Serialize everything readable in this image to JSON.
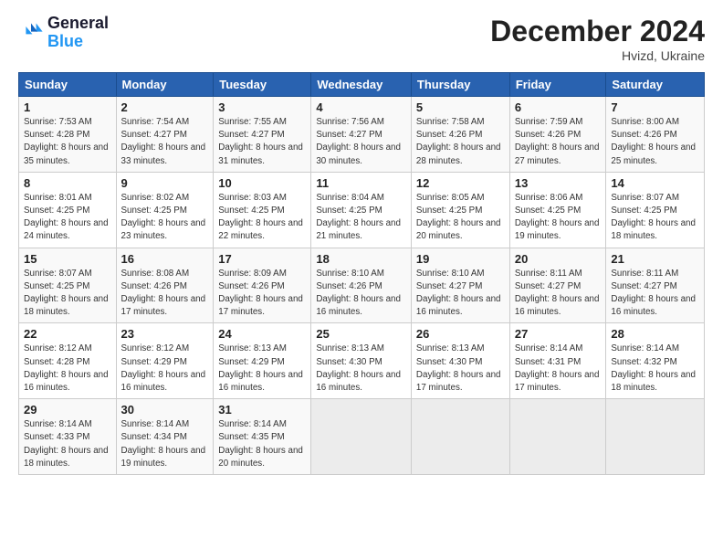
{
  "header": {
    "logo_line1": "General",
    "logo_line2": "Blue",
    "month": "December 2024",
    "location": "Hvizd, Ukraine"
  },
  "weekdays": [
    "Sunday",
    "Monday",
    "Tuesday",
    "Wednesday",
    "Thursday",
    "Friday",
    "Saturday"
  ],
  "weeks": [
    [
      {
        "day": "1",
        "info": "Sunrise: 7:53 AM\nSunset: 4:28 PM\nDaylight: 8 hours\nand 35 minutes."
      },
      {
        "day": "2",
        "info": "Sunrise: 7:54 AM\nSunset: 4:27 PM\nDaylight: 8 hours\nand 33 minutes."
      },
      {
        "day": "3",
        "info": "Sunrise: 7:55 AM\nSunset: 4:27 PM\nDaylight: 8 hours\nand 31 minutes."
      },
      {
        "day": "4",
        "info": "Sunrise: 7:56 AM\nSunset: 4:27 PM\nDaylight: 8 hours\nand 30 minutes."
      },
      {
        "day": "5",
        "info": "Sunrise: 7:58 AM\nSunset: 4:26 PM\nDaylight: 8 hours\nand 28 minutes."
      },
      {
        "day": "6",
        "info": "Sunrise: 7:59 AM\nSunset: 4:26 PM\nDaylight: 8 hours\nand 27 minutes."
      },
      {
        "day": "7",
        "info": "Sunrise: 8:00 AM\nSunset: 4:26 PM\nDaylight: 8 hours\nand 25 minutes."
      }
    ],
    [
      {
        "day": "8",
        "info": "Sunrise: 8:01 AM\nSunset: 4:25 PM\nDaylight: 8 hours\nand 24 minutes."
      },
      {
        "day": "9",
        "info": "Sunrise: 8:02 AM\nSunset: 4:25 PM\nDaylight: 8 hours\nand 23 minutes."
      },
      {
        "day": "10",
        "info": "Sunrise: 8:03 AM\nSunset: 4:25 PM\nDaylight: 8 hours\nand 22 minutes."
      },
      {
        "day": "11",
        "info": "Sunrise: 8:04 AM\nSunset: 4:25 PM\nDaylight: 8 hours\nand 21 minutes."
      },
      {
        "day": "12",
        "info": "Sunrise: 8:05 AM\nSunset: 4:25 PM\nDaylight: 8 hours\nand 20 minutes."
      },
      {
        "day": "13",
        "info": "Sunrise: 8:06 AM\nSunset: 4:25 PM\nDaylight: 8 hours\nand 19 minutes."
      },
      {
        "day": "14",
        "info": "Sunrise: 8:07 AM\nSunset: 4:25 PM\nDaylight: 8 hours\nand 18 minutes."
      }
    ],
    [
      {
        "day": "15",
        "info": "Sunrise: 8:07 AM\nSunset: 4:25 PM\nDaylight: 8 hours\nand 18 minutes."
      },
      {
        "day": "16",
        "info": "Sunrise: 8:08 AM\nSunset: 4:26 PM\nDaylight: 8 hours\nand 17 minutes."
      },
      {
        "day": "17",
        "info": "Sunrise: 8:09 AM\nSunset: 4:26 PM\nDaylight: 8 hours\nand 17 minutes."
      },
      {
        "day": "18",
        "info": "Sunrise: 8:10 AM\nSunset: 4:26 PM\nDaylight: 8 hours\nand 16 minutes."
      },
      {
        "day": "19",
        "info": "Sunrise: 8:10 AM\nSunset: 4:27 PM\nDaylight: 8 hours\nand 16 minutes."
      },
      {
        "day": "20",
        "info": "Sunrise: 8:11 AM\nSunset: 4:27 PM\nDaylight: 8 hours\nand 16 minutes."
      },
      {
        "day": "21",
        "info": "Sunrise: 8:11 AM\nSunset: 4:27 PM\nDaylight: 8 hours\nand 16 minutes."
      }
    ],
    [
      {
        "day": "22",
        "info": "Sunrise: 8:12 AM\nSunset: 4:28 PM\nDaylight: 8 hours\nand 16 minutes."
      },
      {
        "day": "23",
        "info": "Sunrise: 8:12 AM\nSunset: 4:29 PM\nDaylight: 8 hours\nand 16 minutes."
      },
      {
        "day": "24",
        "info": "Sunrise: 8:13 AM\nSunset: 4:29 PM\nDaylight: 8 hours\nand 16 minutes."
      },
      {
        "day": "25",
        "info": "Sunrise: 8:13 AM\nSunset: 4:30 PM\nDaylight: 8 hours\nand 16 minutes."
      },
      {
        "day": "26",
        "info": "Sunrise: 8:13 AM\nSunset: 4:30 PM\nDaylight: 8 hours\nand 17 minutes."
      },
      {
        "day": "27",
        "info": "Sunrise: 8:14 AM\nSunset: 4:31 PM\nDaylight: 8 hours\nand 17 minutes."
      },
      {
        "day": "28",
        "info": "Sunrise: 8:14 AM\nSunset: 4:32 PM\nDaylight: 8 hours\nand 18 minutes."
      }
    ],
    [
      {
        "day": "29",
        "info": "Sunrise: 8:14 AM\nSunset: 4:33 PM\nDaylight: 8 hours\nand 18 minutes."
      },
      {
        "day": "30",
        "info": "Sunrise: 8:14 AM\nSunset: 4:34 PM\nDaylight: 8 hours\nand 19 minutes."
      },
      {
        "day": "31",
        "info": "Sunrise: 8:14 AM\nSunset: 4:35 PM\nDaylight: 8 hours\nand 20 minutes."
      },
      {
        "day": "",
        "info": ""
      },
      {
        "day": "",
        "info": ""
      },
      {
        "day": "",
        "info": ""
      },
      {
        "day": "",
        "info": ""
      }
    ]
  ]
}
